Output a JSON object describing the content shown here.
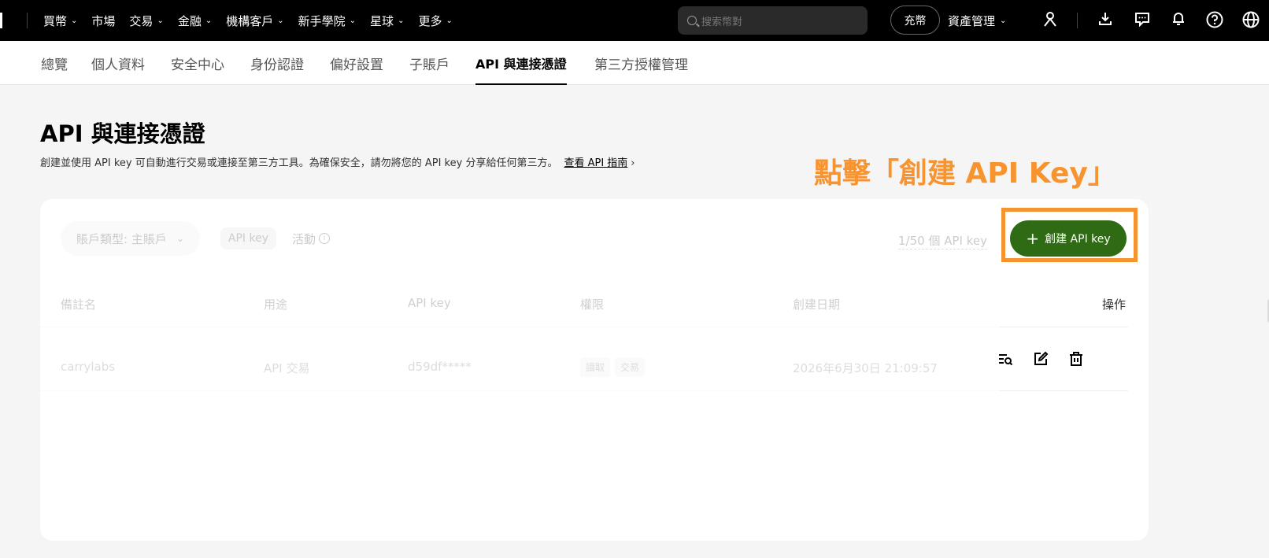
{
  "topnav": {
    "items": [
      {
        "label": "買幣",
        "has_menu": true
      },
      {
        "label": "市場",
        "has_menu": false
      },
      {
        "label": "交易",
        "has_menu": true
      },
      {
        "label": "金融",
        "has_menu": true
      },
      {
        "label": "機構客戶",
        "has_menu": true
      },
      {
        "label": "新手學院",
        "has_menu": true
      },
      {
        "label": "星球",
        "has_menu": true
      },
      {
        "label": "更多",
        "has_menu": true
      }
    ],
    "search_placeholder": "搜索幣對",
    "deposit_label": "充幣",
    "asset_label": "資產管理",
    "icons": [
      "user-icon",
      "download-icon",
      "message-icon",
      "bell-icon",
      "help-icon",
      "globe-icon"
    ]
  },
  "subnav": {
    "tabs": [
      "總覽",
      "個人資料",
      "安全中心",
      "身份認證",
      "偏好設置",
      "子賬戶",
      "API 與連接憑證",
      "第三方授權管理"
    ],
    "active_index": 6
  },
  "page": {
    "title": "API 與連接憑證",
    "description": "創建並使用 API key 可自動進行交易或連接至第三方工具。為確保安全，請勿將您的 API key 分享給任何第三方。",
    "guide_link": "查看 API 指南",
    "annotation": "點擊「創建 API Key」"
  },
  "filters": {
    "account_type": "賬戶類型: 主賬戶",
    "tab_api_key": "API key",
    "tab_activity": "活動",
    "count": "1/50 個 API key",
    "create_button": "創建 API key"
  },
  "table": {
    "headers": {
      "remark": "備註名",
      "purpose": "用途",
      "api_key": "API key",
      "permission": "權限",
      "created": "創建日期",
      "actions": "操作"
    },
    "rows": [
      {
        "remark": "carrylabs",
        "purpose": "API 交易",
        "api_key": "d59df*****",
        "permissions": [
          "讀取",
          "交易"
        ],
        "created": "2026年6月30日 21:09:57"
      }
    ]
  },
  "colors": {
    "accent": "#f7942f",
    "button_green": "#2e6b14"
  }
}
